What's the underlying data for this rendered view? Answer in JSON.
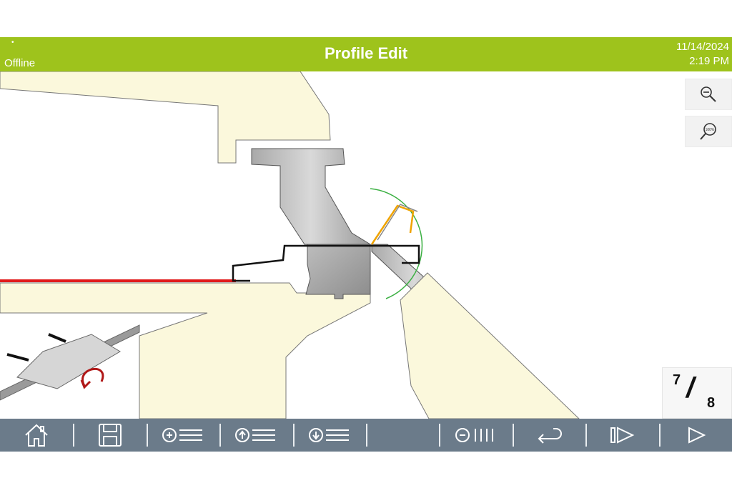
{
  "header": {
    "status_dot": "•",
    "status": "Offline",
    "title": "Profile Edit",
    "date": "11/14/2024",
    "time": "2:19 PM",
    "color": "#9ec31c"
  },
  "zoom": {
    "zoom_out_icon": "zoom-out-icon",
    "zoom_reset_icon": "zoom-100-icon",
    "zoom_reset_label": "100%"
  },
  "page_indicator": {
    "current": "7",
    "separator": "/",
    "total": "8"
  },
  "toolbar": {
    "color": "#6b7b8a",
    "buttons": [
      "home-icon",
      "save-icon",
      "add-bend-icon",
      "move-bend-up-icon",
      "move-bend-down-icon",
      "empty-slot",
      "delete-bends-icon",
      "undo-icon",
      "step-forward-icon",
      "play-icon"
    ]
  },
  "canvas": {
    "machine_color": "#fbf8dc",
    "sheet_color": "#e11a1a",
    "profile_color": "#111111",
    "bend_arc_color": "#3cb043",
    "preview_color": "#f0a400"
  }
}
